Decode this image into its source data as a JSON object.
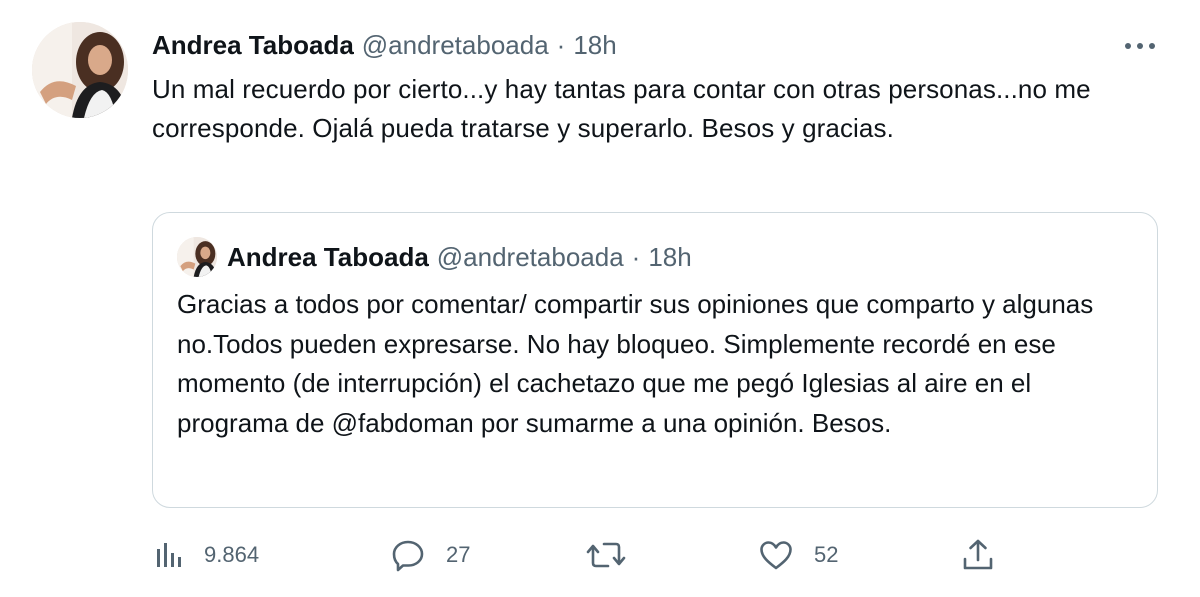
{
  "tweet": {
    "author_name": "Andrea Taboada",
    "author_handle": "@andretaboada",
    "separator": "·",
    "time": "18h",
    "text": "Un mal recuerdo por cierto...y hay tantas para contar con otras personas...no me corresponde. Ojalá pueda tratarse y superarlo.  Besos y gracias.",
    "more_icon": "more-horizontal-icon"
  },
  "quoted_tweet": {
    "author_name": "Andrea Taboada",
    "author_handle": "@andretaboada",
    "separator": "·",
    "time": "18h",
    "text": "Gracias a todos por comentar/ compartir sus opiniones que comparto y algunas no.Todos pueden expresarse. No hay bloqueo. Simplemente recordé en ese momento (de interrupción) el cachetazo que me pegó Iglesias al aire en el programa de @fabdoman por sumarme a una opinión. Besos."
  },
  "actions": {
    "views": {
      "icon": "views-chart-icon",
      "count": "9.864"
    },
    "replies": {
      "icon": "reply-bubble-icon",
      "count": "27"
    },
    "retweets": {
      "icon": "retweet-icon",
      "count": ""
    },
    "likes": {
      "icon": "heart-icon",
      "count": "52"
    },
    "share": {
      "icon": "share-upload-icon",
      "count": ""
    }
  },
  "colors": {
    "text_primary": "#0f1419",
    "text_secondary": "#536471",
    "border": "#cfd9de"
  }
}
